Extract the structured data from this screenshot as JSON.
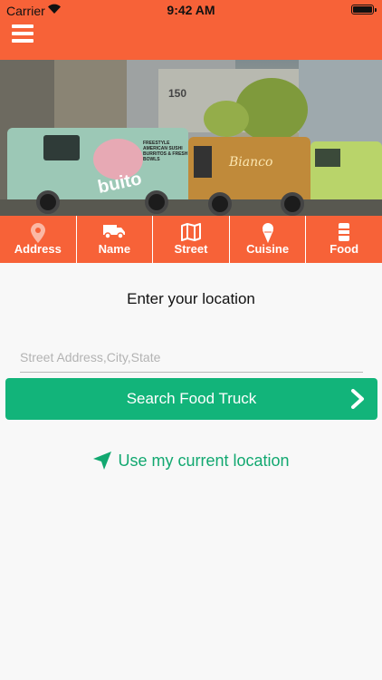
{
  "status_bar": {
    "carrier": "Carrier",
    "time": "9:42 AM"
  },
  "header": {
    "menu_icon": "hamburger-menu-icon",
    "color": "#f76238"
  },
  "hero": {
    "truck_text_1": "FREESTYLE AMERICAN SUSHI BURRITOS & FRESH BOWLS",
    "truck_text_2": "buito",
    "truck_text_3": "Bianco",
    "building_number": "150"
  },
  "search_tabs": [
    {
      "label": "Address",
      "icon": "map-pin-icon"
    },
    {
      "label": "Name",
      "icon": "truck-icon"
    },
    {
      "label": "Street",
      "icon": "map-icon"
    },
    {
      "label": "Cuisine",
      "icon": "ice-cream-icon"
    },
    {
      "label": "Food",
      "icon": "drink-can-icon"
    }
  ],
  "main": {
    "prompt": "Enter your location",
    "location_placeholder": "Street Address,City,State",
    "location_value": "",
    "search_button_label": "Search Food Truck",
    "current_location_label": "Use my current location"
  },
  "colors": {
    "accent": "#f76238",
    "button": "#12b47a",
    "link": "#12a870"
  }
}
